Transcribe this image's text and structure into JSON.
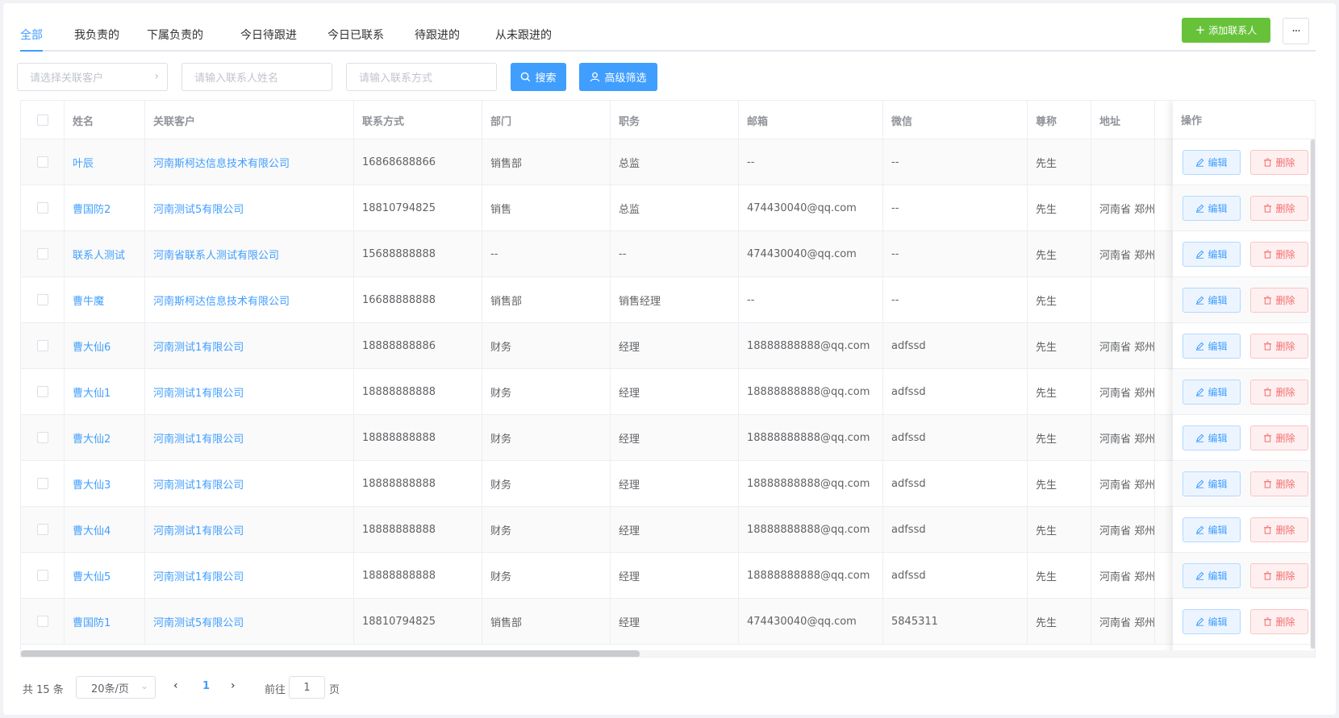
{
  "tabs": [
    "全部",
    "我负责的",
    "下属负责的",
    "今日待跟进",
    "今日已联系",
    "待跟进的",
    "从未跟进的"
  ],
  "toolbar": {
    "add_label": "添加联系人",
    "more_label": "···"
  },
  "filters": {
    "customer_placeholder": "请选择关联客户",
    "name_placeholder": "请输入联系人姓名",
    "contact_placeholder": "请输入联系方式",
    "search_label": "搜索",
    "advanced_label": "高级筛选"
  },
  "table": {
    "columns": [
      "姓名",
      "关联客户",
      "联系方式",
      "部门",
      "职务",
      "邮箱",
      "微信",
      "尊称",
      "地址",
      "操作"
    ],
    "rows": [
      [
        "叶辰",
        "河南斯柯达信息技术有限公司",
        "16868688866",
        "销售部",
        "总监",
        "--",
        "--",
        "先生",
        ""
      ],
      [
        "曹国防2",
        "河南测试5有限公司",
        "18810794825",
        "销售",
        "总监",
        "474430040@qq.com",
        "--",
        "先生",
        "河南省 郑州"
      ],
      [
        "联系人测试",
        "河南省联系人测试有限公司",
        "15688888888",
        "--",
        "--",
        "474430040@qq.com",
        "--",
        "先生",
        "河南省 郑州"
      ],
      [
        "曹牛魔",
        "河南斯柯达信息技术有限公司",
        "16688888888",
        "销售部",
        "销售经理",
        "--",
        "--",
        "先生",
        ""
      ],
      [
        "曹大仙6",
        "河南测试1有限公司",
        "18888888886",
        "财务",
        "经理",
        "18888888888@qq.com",
        "adfssd",
        "先生",
        "河南省 郑州"
      ],
      [
        "曹大仙1",
        "河南测试1有限公司",
        "18888888888",
        "财务",
        "经理",
        "18888888888@qq.com",
        "adfssd",
        "先生",
        "河南省 郑州"
      ],
      [
        "曹大仙2",
        "河南测试1有限公司",
        "18888888888",
        "财务",
        "经理",
        "18888888888@qq.com",
        "adfssd",
        "先生",
        "河南省 郑州"
      ],
      [
        "曹大仙3",
        "河南测试1有限公司",
        "18888888888",
        "财务",
        "经理",
        "18888888888@qq.com",
        "adfssd",
        "先生",
        "河南省 郑州"
      ],
      [
        "曹大仙4",
        "河南测试1有限公司",
        "18888888888",
        "财务",
        "经理",
        "18888888888@qq.com",
        "adfssd",
        "先生",
        "河南省 郑州"
      ],
      [
        "曹大仙5",
        "河南测试1有限公司",
        "18888888888",
        "财务",
        "经理",
        "18888888888@qq.com",
        "adfssd",
        "先生",
        "河南省 郑州"
      ],
      [
        "曹国防1",
        "河南测试5有限公司",
        "18810794825",
        "销售部",
        "经理",
        "474430040@qq.com",
        "5845311",
        "先生",
        "河南省 郑州"
      ]
    ],
    "edit_label": "编辑",
    "delete_label": "删除"
  },
  "pagination": {
    "total_text": "共 15 条",
    "page_size": "20条/页",
    "current_page": "1",
    "goto_label": "前往",
    "goto_value": "1",
    "page_suffix": "页"
  },
  "colors": {
    "primary": "#409eff",
    "success": "#67c23a",
    "danger": "#f56c6c"
  }
}
